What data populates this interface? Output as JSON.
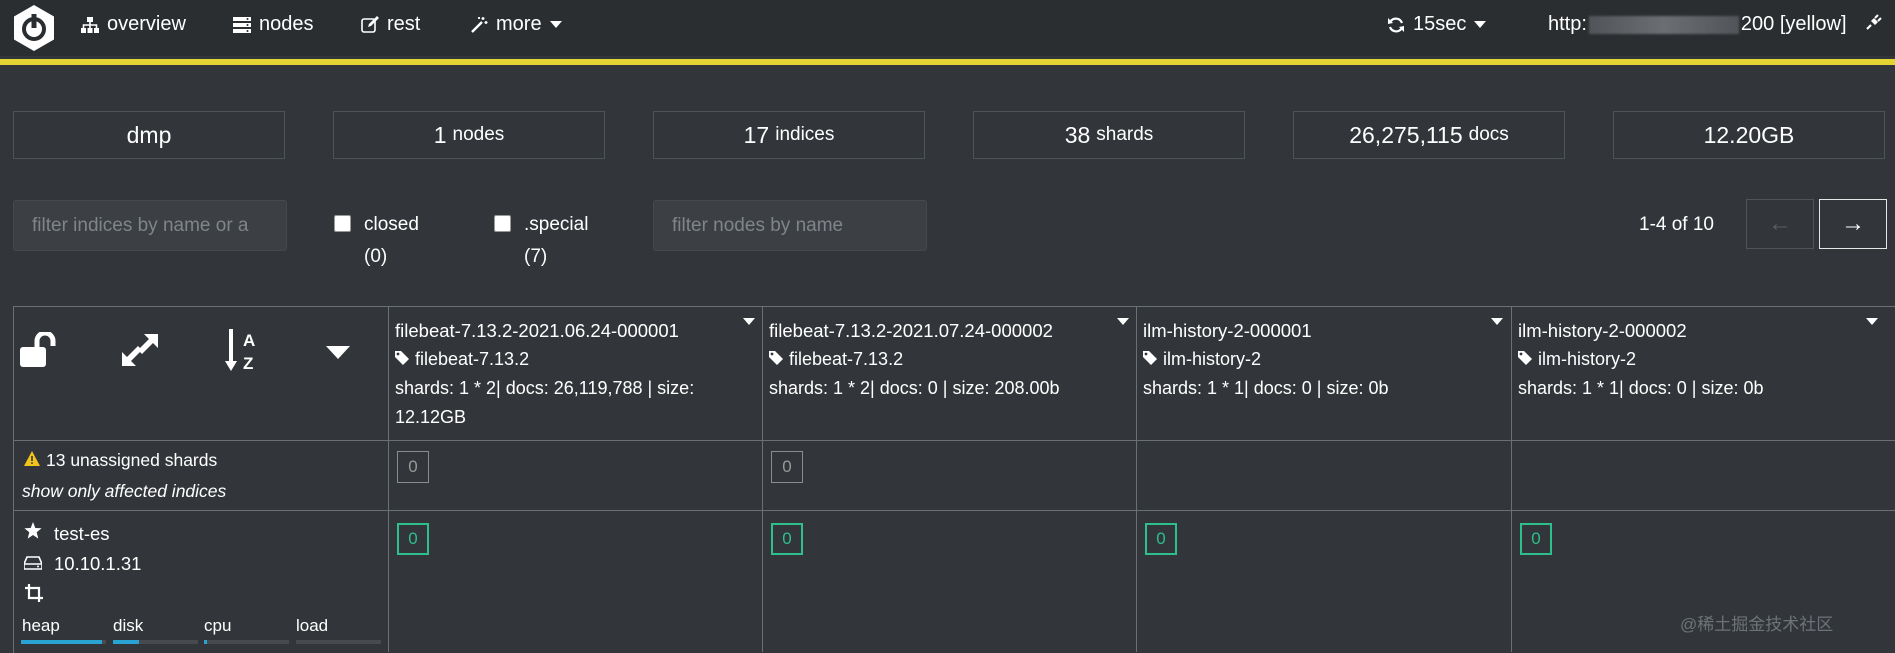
{
  "nav": {
    "overview": "overview",
    "nodes": "nodes",
    "rest": "rest",
    "more": "more",
    "refresh": "15sec",
    "url_prefix": "http:",
    "url_suffix": "200 [yellow]"
  },
  "stats": {
    "cluster": "dmp",
    "nodes_value": "1",
    "nodes_unit": "nodes",
    "indices_value": "17",
    "indices_unit": "indices",
    "shards_value": "38",
    "shards_unit": "shards",
    "docs_value": "26,275,115",
    "docs_unit": "docs",
    "size": "12.20GB"
  },
  "filters": {
    "indices_placeholder": "filter indices by name or a",
    "closed_label": "closed",
    "closed_count": "(0)",
    "special_label": ".special",
    "special_count": "(7)",
    "nodes_placeholder": "filter nodes by name",
    "pager_text": "1-4 of 10",
    "prev_label": "←",
    "next_label": "→"
  },
  "indices": [
    {
      "name": "filebeat-7.13.2-2021.06.24-000001",
      "alias": "filebeat-7.13.2",
      "info": "shards: 1 * 2| docs: 26,119,788 | size:",
      "info2": "12.12GB",
      "unassigned": "0",
      "shard": "0"
    },
    {
      "name": "filebeat-7.13.2-2021.07.24-000002",
      "alias": "filebeat-7.13.2",
      "info": "shards: 1 * 2| docs: 0 | size: 208.00b",
      "info2": "",
      "unassigned": "0",
      "shard": "0"
    },
    {
      "name": "ilm-history-2-000001",
      "alias": "ilm-history-2",
      "info": "shards: 1 * 1| docs: 0 | size: 0b",
      "info2": "",
      "unassigned": "",
      "shard": "0"
    },
    {
      "name": "ilm-history-2-000002",
      "alias": "ilm-history-2",
      "info": "shards: 1 * 1| docs: 0 | size: 0b",
      "info2": "",
      "unassigned": "",
      "shard": "0"
    }
  ],
  "unassigned": {
    "text": "13 unassigned shards",
    "link": "show only affected indices"
  },
  "node": {
    "name": "test-es",
    "ip": "10.10.1.31",
    "metrics": [
      {
        "label": "heap",
        "level": 0.95
      },
      {
        "label": "disk",
        "level": 0.3
      },
      {
        "label": "cpu",
        "level": 0.03
      },
      {
        "label": "load",
        "level": 0
      }
    ]
  },
  "watermark": "@稀土掘金技术社区",
  "colors": {
    "accent": "#e3d433",
    "shard_ok": "#2dbf8c",
    "bar": "#29a3d1"
  },
  "icons": [
    "logo-icon",
    "sitemap-icon",
    "server-icon",
    "edit-icon",
    "magic-icon",
    "caret-down-icon",
    "refresh-icon",
    "plug-icon",
    "unlock-icon",
    "expand-icon",
    "sort-az-icon",
    "tag-icon",
    "warning-icon",
    "star-icon",
    "hdd-icon",
    "crop-icon"
  ]
}
